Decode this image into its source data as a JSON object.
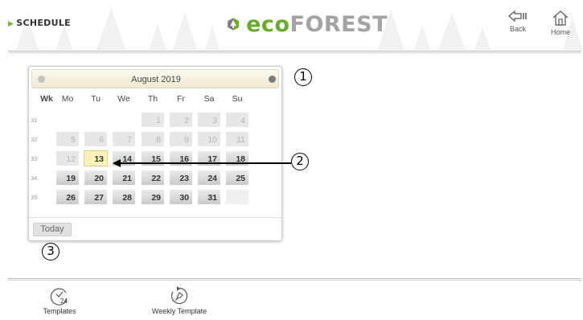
{
  "header": {
    "section_title": "SCHEDULE",
    "logo_eco": "eco",
    "logo_forest": "FOREST",
    "back_label": "Back",
    "home_label": "Home"
  },
  "calendar": {
    "month_label": "August 2019",
    "week_header": "Wk",
    "weekdays": [
      "Mo",
      "Tu",
      "We",
      "Th",
      "Fr",
      "Sa",
      "Su"
    ],
    "weeks": [
      {
        "wk": "31",
        "days": [
          "",
          "",
          "",
          "1",
          "2",
          "3",
          "4"
        ]
      },
      {
        "wk": "32",
        "days": [
          "5",
          "6",
          "7",
          "8",
          "9",
          "10",
          "11"
        ]
      },
      {
        "wk": "33",
        "days": [
          "12",
          "13",
          "14",
          "15",
          "16",
          "17",
          "18"
        ]
      },
      {
        "wk": "34",
        "days": [
          "19",
          "20",
          "21",
          "22",
          "23",
          "24",
          "25"
        ]
      },
      {
        "wk": "35",
        "days": [
          "26",
          "27",
          "28",
          "29",
          "30",
          "31",
          ""
        ]
      }
    ],
    "today_date": "13",
    "today_button": "Today"
  },
  "callouts": [
    "1",
    "2",
    "3"
  ],
  "toolbar": {
    "templates_label": "Templates",
    "templates_icon_number": "24",
    "weekly_label": "Weekly Template"
  },
  "colors": {
    "brand_green": "#6aab2e",
    "brand_grey": "#a3a3a3",
    "today_highlight": "#fff1b8"
  },
  "icons": {
    "back": "back-arrow-icon",
    "home": "home-icon",
    "templates": "clock-24-icon",
    "weekly": "weekly-template-icon"
  }
}
